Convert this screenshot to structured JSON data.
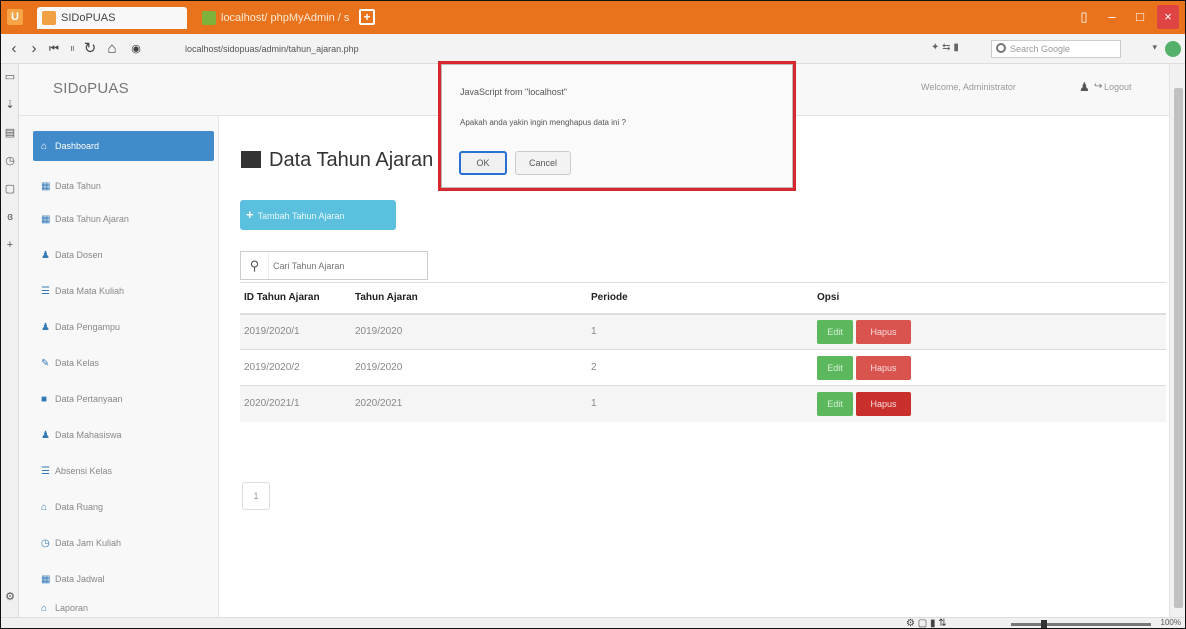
{
  "browser": {
    "tabs": [
      {
        "label": "SIDoPUAS"
      },
      {
        "label": "localhost/ phpMyAdmin / sidopuas"
      }
    ],
    "url": "localhost/sidopuas/admin/tahun_ajaran.php",
    "search_placeholder": "Search Google",
    "zoom": "100%"
  },
  "app": {
    "brand": "SIDoPUAS",
    "user_greeting": "Welcome, Administrator",
    "logout_label": "Logout"
  },
  "sidebar": {
    "items": [
      {
        "label": "Dashboard",
        "icon": "home-icon",
        "active": true
      },
      {
        "label": "Data Tahun",
        "icon": "table-icon"
      },
      {
        "label": "Data Tahun Ajaran",
        "icon": "table-icon"
      },
      {
        "label": "Data Dosen",
        "icon": "user-icon"
      },
      {
        "label": "Data Mata Kuliah",
        "icon": "list-icon"
      },
      {
        "label": "Data Pengampu",
        "icon": "user-icon"
      },
      {
        "label": "Data Kelas",
        "icon": "pencil-icon"
      },
      {
        "label": "Data Pertanyaan",
        "icon": "book-icon"
      },
      {
        "label": "Data Mahasiswa",
        "icon": "user-icon"
      },
      {
        "label": "Absensi Kelas",
        "icon": "list-icon"
      },
      {
        "label": "Data Ruang",
        "icon": "home-icon"
      },
      {
        "label": "Data Jam Kuliah",
        "icon": "clock-icon"
      },
      {
        "label": "Data Jadwal",
        "icon": "table-icon"
      },
      {
        "label": "Laporan",
        "icon": "home-icon"
      }
    ]
  },
  "main": {
    "title": "Data Tahun Ajaran",
    "add_button": "Tambah Tahun Ajaran",
    "search_placeholder": "Cari Tahun Ajaran",
    "table": {
      "headers": [
        "ID Tahun Ajaran",
        "Tahun Ajaran",
        "Periode",
        "Opsi"
      ],
      "rows": [
        [
          "2019/2020/1",
          "2019/2020",
          "1"
        ],
        [
          "2019/2020/2",
          "2019/2020",
          "2"
        ],
        [
          "2020/2021/1",
          "2020/2021",
          "1"
        ]
      ],
      "edit_label": "Edit",
      "delete_label": "Hapus"
    },
    "pagination": [
      "1"
    ]
  },
  "dialog": {
    "title": "JavaScript from \"localhost\"",
    "message": "Apakah anda yakin ingin menghapus data ini ?",
    "ok_label": "OK",
    "cancel_label": "Cancel"
  },
  "colors": {
    "browser_accent": "#e8731c",
    "primary": "#428bca",
    "info": "#5bc0de",
    "success": "#5cb85c",
    "danger": "#d9534f",
    "dialog_highlight": "#d9272e"
  }
}
